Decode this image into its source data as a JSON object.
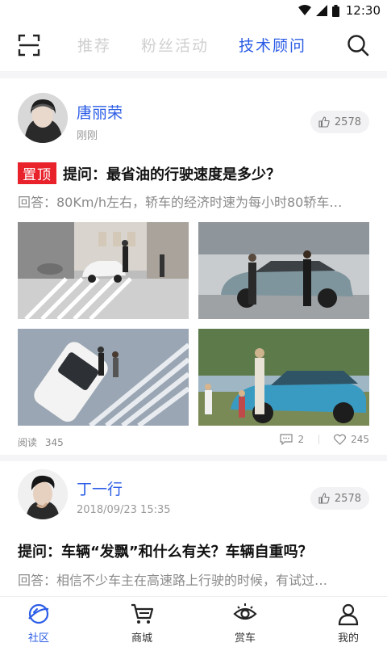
{
  "status_bar": {
    "time": "12:30"
  },
  "top_nav": {
    "tabs": [
      {
        "label": "推荐"
      },
      {
        "label": "粉丝活动"
      },
      {
        "label": "技术顾问"
      }
    ]
  },
  "posts": [
    {
      "author": "唐丽荣",
      "time": "刚刚",
      "likes": "2578",
      "pin_label": "置顶",
      "question": "提问：最省油的行驶速度是多少？",
      "answer": "回答：80Km/h左右，轿车的经济时速为每小时80轿车…",
      "read_label": "阅读",
      "reads": "345",
      "comments": "2",
      "favorites": "245"
    },
    {
      "author": "丁一行",
      "time": "2018/09/23  15:35",
      "likes": "2578",
      "question": "提问：车辆“发飘”和什么有关？车辆自重吗？",
      "answer": "回答：相信不少车主在高速路上行驶的时候，有试过…"
    }
  ],
  "bottom_nav": {
    "items": [
      {
        "label": "社区"
      },
      {
        "label": "商城"
      },
      {
        "label": "赏车"
      },
      {
        "label": "我的"
      }
    ]
  },
  "colors": {
    "accent": "#2b5ce6",
    "pin": "#e8212b",
    "muted": "#8a8a8a"
  }
}
